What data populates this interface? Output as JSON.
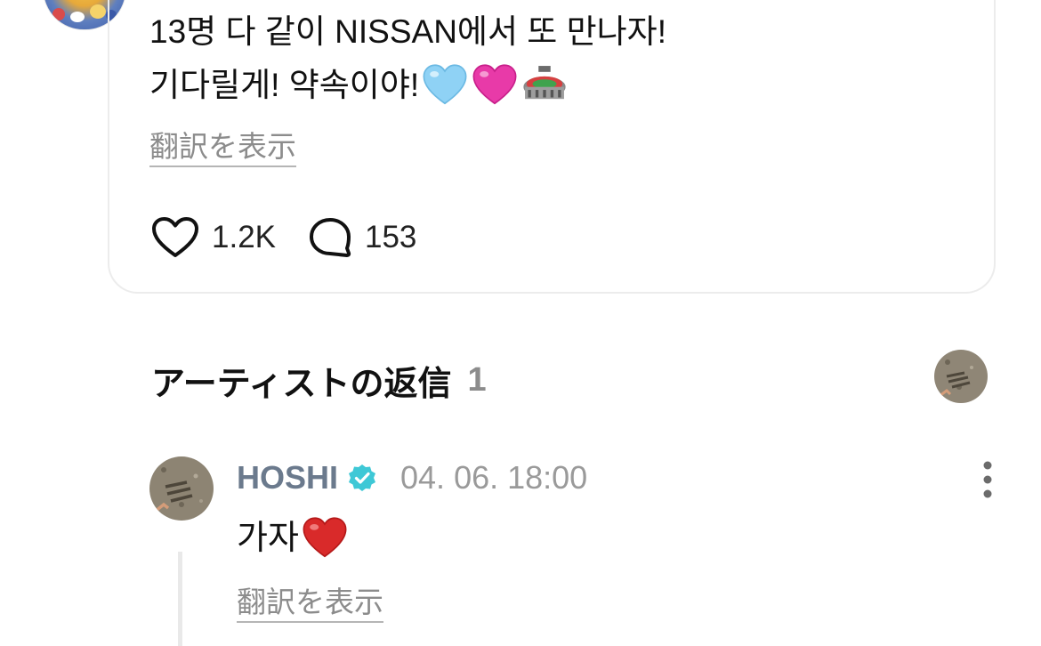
{
  "post": {
    "line1": "13명 다 같이 NISSAN에서 또 만나자!",
    "line2": "기다릴게! 약속이야!",
    "emojis": [
      "light-blue-heart-icon",
      "pink-heart-icon",
      "stadium-icon"
    ],
    "translate_label": "翻訳を表示",
    "likes": "1.2K",
    "comments": "153"
  },
  "replies": {
    "title": "アーティストの返信",
    "count": "1"
  },
  "reply": {
    "author": "HOSHI",
    "timestamp": "04. 06. 18:00",
    "text": "가자",
    "emoji": "red-heart-icon",
    "translate_label": "翻訳を表示"
  },
  "colors": {
    "name": "#6b7a8d",
    "verified": "#3ec8d6",
    "muted": "#8c8c8c",
    "card_border": "#ececec"
  }
}
